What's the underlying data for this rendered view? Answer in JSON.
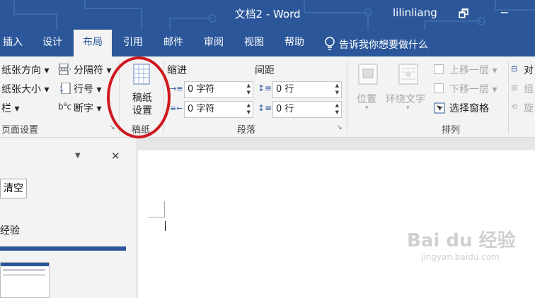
{
  "window": {
    "title": "文档2 - Word",
    "user": "lilinliang",
    "restore_glyph": "🗗",
    "minimize_glyph": "−",
    "title_bg": "#2b579a"
  },
  "tabs": [
    "插入",
    "设计",
    "布局",
    "引用",
    "邮件",
    "审阅",
    "视图",
    "帮助"
  ],
  "active_tab": "布局",
  "tell_me": "告诉我你想要做什么",
  "page_setup": {
    "orientation": "纸张方向",
    "size": "纸张大小",
    "columns": "栏",
    "breaks": "分隔符",
    "line_numbers": "行号",
    "hyphenation": "断字",
    "group_label": "页面设置"
  },
  "manuscript": {
    "button_line1": "稿纸",
    "button_line2": "设置",
    "group_label": "稿纸"
  },
  "paragraph": {
    "indent_label": "缩进",
    "spacing_label": "间距",
    "indent_left": "0 字符",
    "indent_right": "0 字符",
    "spacing_before": "0 行",
    "spacing_after": "0 行",
    "group_label": "段落"
  },
  "arrange": {
    "position": "位置",
    "wrap_text": "环绕文字",
    "bring_forward": "上移一层",
    "send_backward": "下移一层",
    "selection_pane": "选择窗格",
    "align": "对",
    "group_obj": "组",
    "rotate": "旋",
    "group_label": "排列"
  },
  "side_pane": {
    "clear_button": "清空",
    "item_text": "经验",
    "dropdown_glyph": "▼",
    "close_glyph": "✕"
  },
  "watermark": {
    "logo": "Bai du 经验",
    "url": "jingyan.baidu.com"
  },
  "colors": {
    "accent": "#2b579a",
    "highlight_circle": "#d0171f"
  }
}
